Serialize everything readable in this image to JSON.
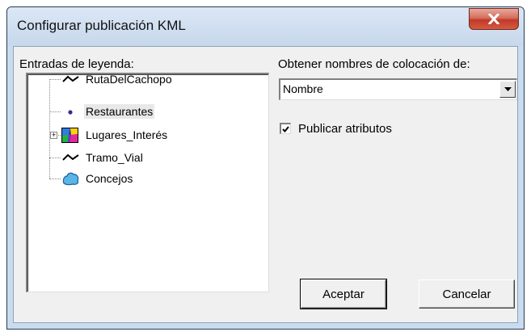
{
  "window": {
    "title": "Configurar publicación KML"
  },
  "legend": {
    "label": "Entradas de leyenda:",
    "items": [
      {
        "label": "RutaDelCachopo",
        "icon": "line-symbol-icon",
        "selected": false,
        "expandable": false
      },
      {
        "label": "Restaurantes",
        "icon": "point-symbol-icon",
        "selected": true,
        "expandable": false
      },
      {
        "label": "Lugares_Interés",
        "icon": "multicolor-polygon-icon",
        "selected": false,
        "expandable": true
      },
      {
        "label": "Tramo_Vial",
        "icon": "line-symbol-icon",
        "selected": false,
        "expandable": false
      },
      {
        "label": "Concejos",
        "icon": "polygon-symbol-icon",
        "selected": false,
        "expandable": false
      }
    ]
  },
  "placemarks": {
    "label": "Obtener nombres de colocación de:",
    "selected_value": "Nombre"
  },
  "publish_attributes": {
    "label": "Publicar atributos",
    "checked": true
  },
  "buttons": {
    "ok_label": "Aceptar",
    "cancel_label": "Cancelar"
  },
  "colors": {
    "title_bar": "#c9dbee",
    "dialog_background": "#f0f0f0",
    "close_button": "#c2392a",
    "point_symbol": "#3a2a8c",
    "polygon_symbol": "#5ab4e6"
  }
}
